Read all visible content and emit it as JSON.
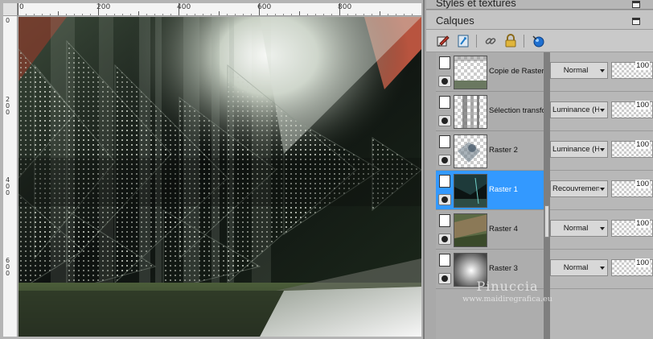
{
  "panels": {
    "styles_title": "Styles et textures",
    "layers_title": "Calques"
  },
  "toolbar": {
    "icons": [
      "new-raster-layer-icon",
      "new-vector-layer-icon",
      "link-icon",
      "lock-icon",
      "mask-icon"
    ]
  },
  "ruler": {
    "top": [
      "0",
      "200",
      "400",
      "600",
      "800"
    ],
    "left": [
      "0",
      "200",
      "400",
      "600"
    ]
  },
  "layers": [
    {
      "name": "Copie de Raster",
      "blend": "Normal",
      "opacity": "100"
    },
    {
      "name": "Sélection transfo",
      "blend": "Luminance (H)",
      "opacity": "100"
    },
    {
      "name": "Raster 2",
      "blend": "Luminance (H)",
      "opacity": "100"
    },
    {
      "name": "Raster 1",
      "blend": "Recouvrement",
      "opacity": "100"
    },
    {
      "name": "Raster 4",
      "blend": "Normal",
      "opacity": "100"
    },
    {
      "name": "Raster 3",
      "blend": "Normal",
      "opacity": "100"
    }
  ],
  "watermark": {
    "name": "Pinuccia",
    "url": "www.maidiregrafica.eu"
  },
  "colors": {
    "selected_row": "#3399ff",
    "accent_red": "#c05a45"
  }
}
